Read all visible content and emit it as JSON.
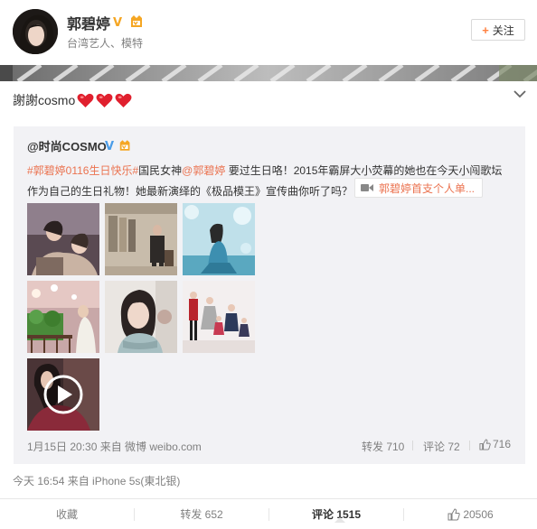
{
  "user": {
    "name": "郭碧婷",
    "description": "台湾艺人、模特",
    "follow_label": "关注"
  },
  "post": {
    "text": "謝謝cosmo",
    "hearts": 3,
    "time_source": "今天 16:54 来自 iPhone 5s(東北银)"
  },
  "repost": {
    "author": "@时尚COSMO",
    "hashtag": "#郭碧婷0116生日快乐#",
    "line1_mid": "国民女神",
    "mention": "@郭碧婷",
    "line1_tail": " 要过生日咯！2015年霸屏大小荧幕的她也在今天小闯歌坛",
    "line2": "作为自己的生日礼物！她最新演绎的《极品模王》宣传曲你听了吗？",
    "video_link": "郭碧婷首支个人单...",
    "time_source": "1月15日 20:30 来自 微博 weibo.com",
    "repost_label": "转发 710",
    "comment_label": "评论 72",
    "like_count": "716"
  },
  "actions": {
    "favorite": "收藏",
    "repost": "转发 652",
    "comment": "评论 1515",
    "like": "20506"
  },
  "colors": {
    "accent": "#eb7350",
    "verified": "#f5a623",
    "heart": "#e0202e"
  }
}
